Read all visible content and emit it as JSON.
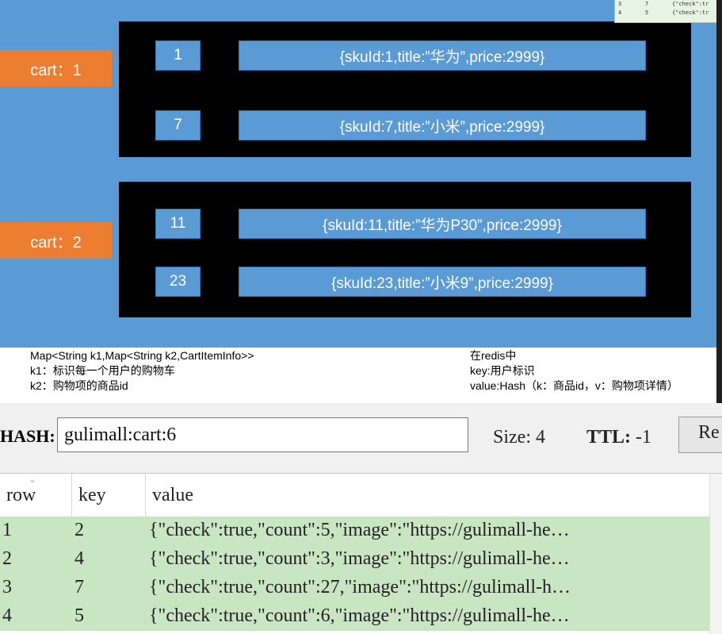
{
  "diagram": {
    "groups": [
      {
        "cart_label": "cart：1",
        "items": [
          {
            "key": "1",
            "value": "{skuId:1,title:”华为”,price:2999}"
          },
          {
            "key": "7",
            "value": "{skuId:7,title:”小米”,price:2999}"
          }
        ]
      },
      {
        "cart_label": "cart：2",
        "items": [
          {
            "key": "11",
            "value": "{skuId:11,title:”华为P30”,price:2999}"
          },
          {
            "key": "23",
            "value": "{skuId:23,title:”小米9”,price:2999}"
          }
        ]
      }
    ],
    "description_left": [
      "Map<String k1,Map<String k2,CartItemInfo>>",
      "k1：标识每一个用户的购物车",
      "k2：购物项的商品id"
    ],
    "description_right": [
      "在redis中",
      "key:用户标识",
      "value:Hash（k：商品id，v：购物项详情）"
    ],
    "mini_table_rows": [
      {
        "row": "3",
        "key": "7",
        "value": "{\"check\":tr"
      },
      {
        "row": "4",
        "key": "5",
        "value": "{\"check\":tr"
      }
    ]
  },
  "viewer": {
    "type_label": "HASH:",
    "key_value": "gulimall:cart:6",
    "size_label": "Size: 4",
    "ttl_label": "TTL:",
    "ttl_value": " -1",
    "reload_label": "Re",
    "columns": [
      "row",
      "key",
      "value"
    ],
    "rows": [
      {
        "row": "1",
        "key": "2",
        "value": "{\"check\":true,\"count\":5,\"image\":\"https://gulimall-he…"
      },
      {
        "row": "2",
        "key": "4",
        "value": "{\"check\":true,\"count\":3,\"image\":\"https://gulimall-he…"
      },
      {
        "row": "3",
        "key": "7",
        "value": "{\"check\":true,\"count\":27,\"image\":\"https://gulimall-h…"
      },
      {
        "row": "4",
        "key": "5",
        "value": "{\"check\":true,\"count\":6,\"image\":\"https://gulimall-he…"
      }
    ]
  }
}
